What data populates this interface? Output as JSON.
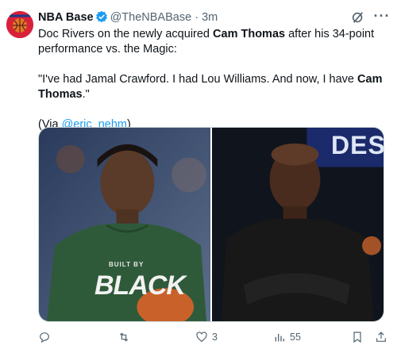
{
  "author": {
    "name": "NBA Base",
    "handle": "@TheNBABase",
    "separator": "·",
    "time": "3m",
    "verified": true
  },
  "icons": {
    "avatar": "basketball-logo-icon",
    "verified": "verified-badge-icon",
    "grok": "grok-icon",
    "more": "more-icon",
    "reply": "reply-icon",
    "retweet": "retweet-icon",
    "like": "heart-icon",
    "views": "views-chart-icon",
    "bookmark": "bookmark-icon",
    "share": "share-icon"
  },
  "colors": {
    "accent": "#1d9bf0",
    "avatar_bg": "#d9213a",
    "secondary_text": "#536471"
  },
  "tweet": {
    "line1_a": "Doc Rivers on the newly acquired ",
    "line1_b": "Cam Thomas",
    "line1_c": " after his 34-point performance vs. the Magic:",
    "quote_a": "\"I've had Jamal Crawford. I had Lou Williams. And now, I have ",
    "quote_b": "Cam Thomas",
    "quote_c": ".\"",
    "via_a": "(Via ",
    "via_link": "@eric_nehm",
    "via_c": ")"
  },
  "media": {
    "left_jersey_small": "BUILT BY",
    "left_jersey_big": "BLACK",
    "right_banner": "DES"
  },
  "stats": {
    "replies": "",
    "retweets": "",
    "likes": "3",
    "views": "55"
  }
}
